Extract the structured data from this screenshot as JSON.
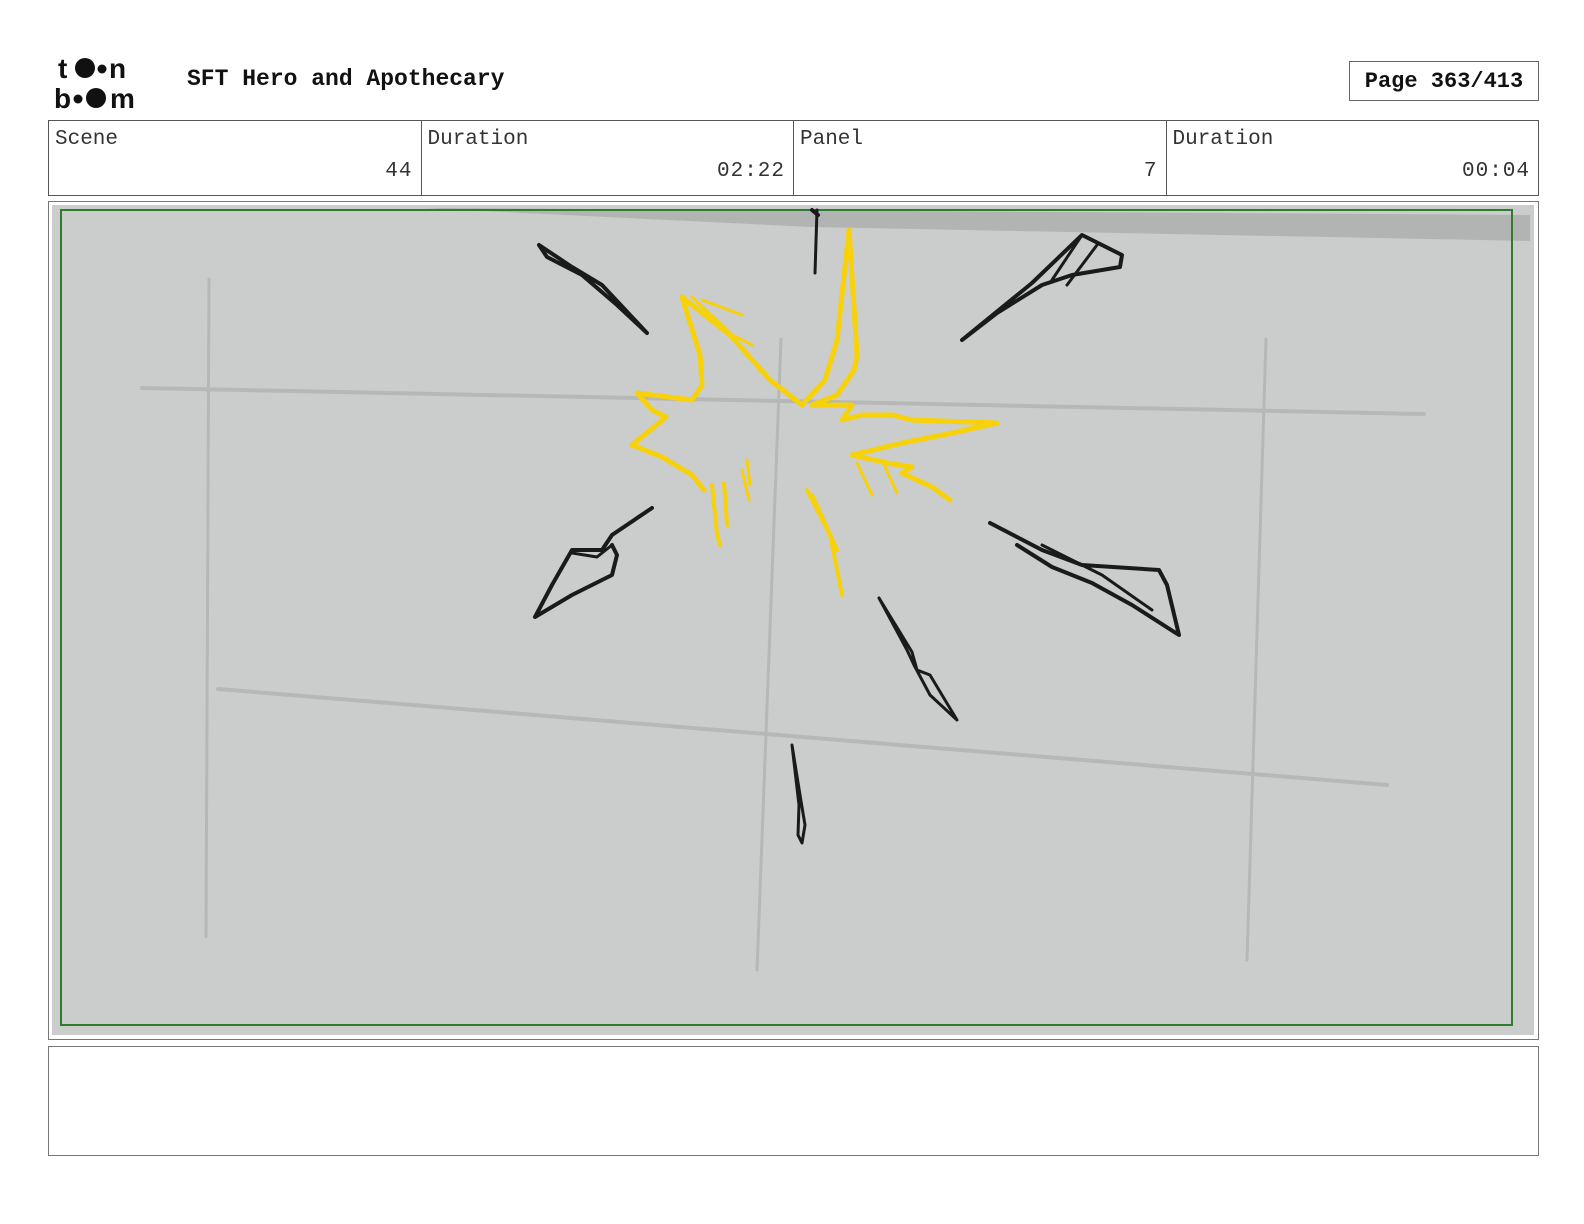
{
  "header": {
    "logo_text": "toon boom",
    "project_title": "SFT Hero and Apothecary",
    "page_label": "Page 363/413"
  },
  "info": {
    "scene_label": "Scene",
    "scene_value": "44",
    "scene_duration_label": "Duration",
    "scene_duration_value": "02:22",
    "panel_label": "Panel",
    "panel_value": "7",
    "panel_duration_label": "Duration",
    "panel_duration_value": "00:04"
  },
  "panel": {
    "background_color": "#cbcdcc",
    "safe_frame_color": "#2e7d2e",
    "burst_color": "#f7d10a",
    "debris_color": "#1a1a1a"
  },
  "notes": {
    "text": ""
  }
}
